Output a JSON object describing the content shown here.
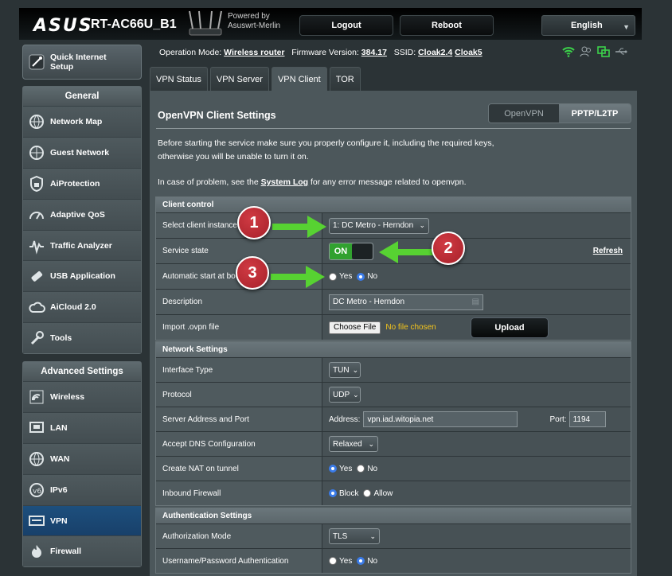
{
  "header": {
    "brand": "ASUS",
    "model": "RT-AC66U_B1",
    "powered_line1": "Powered by",
    "powered_line2": "Asuswrt-Merlin",
    "logout_label": "Logout",
    "reboot_label": "Reboot",
    "language": "English"
  },
  "sidebar": {
    "quick_setup_line1": "Quick Internet",
    "quick_setup_line2": "Setup",
    "general_title": "General",
    "general_items": [
      {
        "label": "Network Map",
        "icon": "network-map-icon"
      },
      {
        "label": "Guest Network",
        "icon": "globe-icon"
      },
      {
        "label": "AiProtection",
        "icon": "lock-icon"
      },
      {
        "label": "Adaptive QoS",
        "icon": "gauge-icon"
      },
      {
        "label": "Traffic Analyzer",
        "icon": "pulse-icon"
      },
      {
        "label": "USB Application",
        "icon": "usb-icon"
      },
      {
        "label": "AiCloud 2.0",
        "icon": "cloud-icon"
      },
      {
        "label": "Tools",
        "icon": "wrench-icon"
      }
    ],
    "advanced_title": "Advanced Settings",
    "advanced_items": [
      {
        "label": "Wireless",
        "icon": "wireless-icon"
      },
      {
        "label": "LAN",
        "icon": "lan-icon"
      },
      {
        "label": "WAN",
        "icon": "wan-icon"
      },
      {
        "label": "IPv6",
        "icon": "ipv6-icon"
      },
      {
        "label": "VPN",
        "icon": "vpn-icon"
      },
      {
        "label": "Firewall",
        "icon": "firewall-icon"
      }
    ]
  },
  "status": {
    "op_mode_label": "Operation Mode:",
    "op_mode_value": "Wireless router",
    "fw_label": "Firmware Version:",
    "fw_value": "384.17",
    "ssid_label": "SSID:",
    "ssid_1": "Cloak2.4",
    "ssid_2": "Cloak5"
  },
  "tabs": [
    "VPN Status",
    "VPN Server",
    "VPN Client",
    "TOR"
  ],
  "panel": {
    "title": "OpenVPN Client Settings",
    "proto_openvpn": "OpenVPN",
    "proto_pptp": "PPTP/L2TP",
    "intro_line1": "Before starting the service make sure you properly configure it, including the required keys,",
    "intro_line2": "otherwise you will be unable to turn it on.",
    "problem_prefix": "In case of problem, see the ",
    "problem_link": "System Log",
    "problem_suffix": " for any error message related to openvpn."
  },
  "client_control": {
    "heading": "Client control",
    "instance_label": "Select client instance",
    "instance_value": "1: DC Metro - Herndon",
    "service_label": "Service state",
    "service_value": "ON",
    "refresh": "Refresh",
    "autostart_label": "Automatic start at boot",
    "yes": "Yes",
    "no": "No",
    "description_label": "Description",
    "description_value": "DC Metro - Herndon",
    "import_label": "Import .ovpn file",
    "choose_file": "Choose File",
    "no_file": "No file chosen",
    "upload": "Upload"
  },
  "network": {
    "heading": "Network Settings",
    "iface_label": "Interface Type",
    "iface_value": "TUN",
    "proto_label": "Protocol",
    "proto_value": "UDP",
    "server_label": "Server Address and Port",
    "address_label": "Address:",
    "address_value": "vpn.iad.witopia.net",
    "port_label": "Port:",
    "port_value": "1194",
    "dns_label": "Accept DNS Configuration",
    "dns_value": "Relaxed",
    "nat_label": "Create NAT on tunnel",
    "yes": "Yes",
    "no": "No",
    "fw_label": "Inbound Firewall",
    "block": "Block",
    "allow": "Allow"
  },
  "auth": {
    "heading": "Authentication Settings",
    "mode_label": "Authorization Mode",
    "mode_value": "TLS",
    "userpass_label": "Username/Password Authentication",
    "yes": "Yes",
    "no": "No"
  },
  "annotations": [
    "1",
    "2",
    "3"
  ],
  "colors": {
    "arrow": "#57d232",
    "badge": "#b82a32",
    "active_nav": "#1d4f7d",
    "toggle_on": "#31a12f"
  }
}
